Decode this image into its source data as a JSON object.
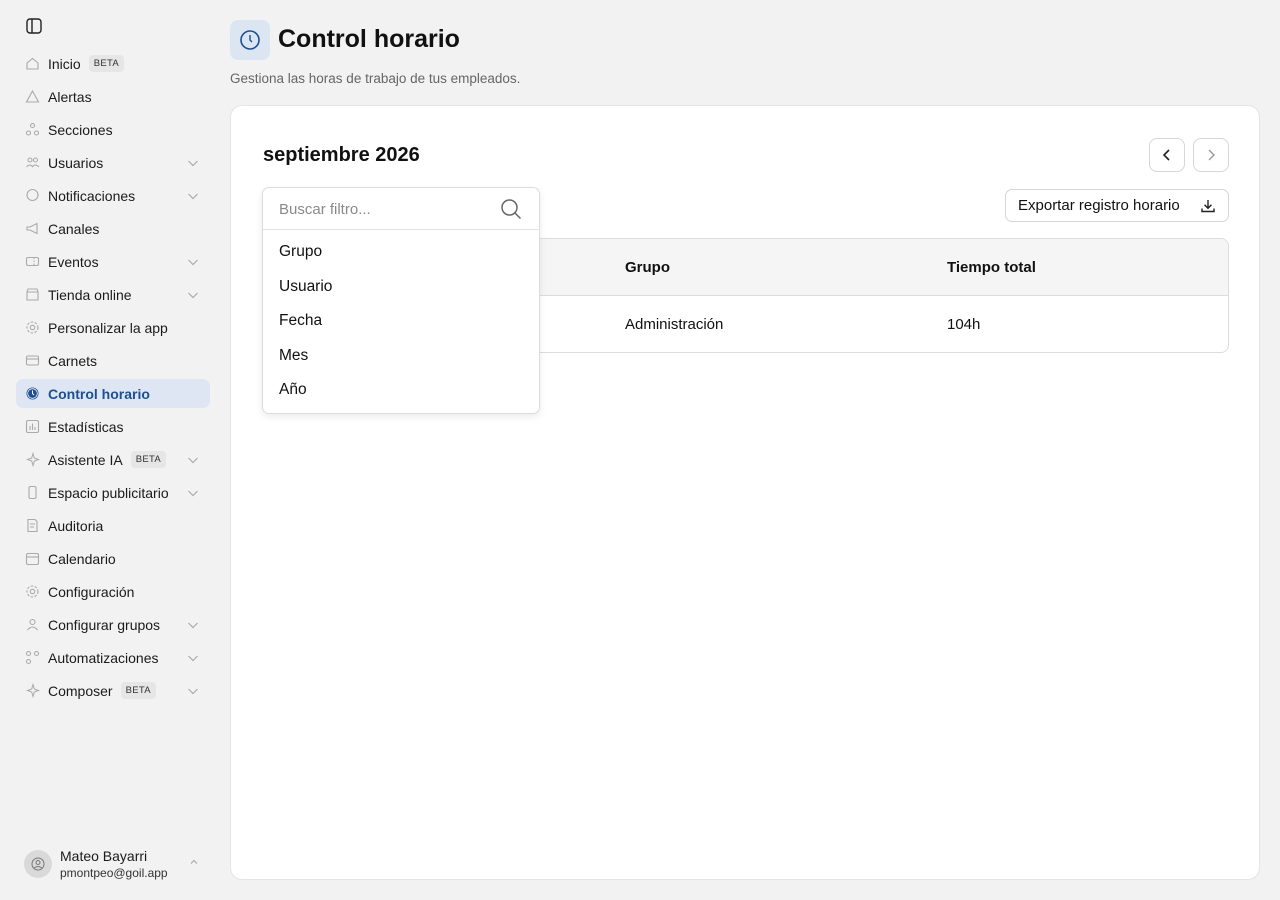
{
  "sidebar": {
    "items": [
      {
        "label": "Inicio",
        "icon": "home-icon",
        "badge": "BETA",
        "chevron": false,
        "active": false
      },
      {
        "label": "Alertas",
        "icon": "alert-icon",
        "badge": null,
        "chevron": false,
        "active": false
      },
      {
        "label": "Secciones",
        "icon": "sections-icon",
        "badge": null,
        "chevron": false,
        "active": false
      },
      {
        "label": "Usuarios",
        "icon": "users-icon",
        "badge": null,
        "chevron": true,
        "active": false
      },
      {
        "label": "Notificaciones",
        "icon": "chat-icon",
        "badge": null,
        "chevron": true,
        "active": false
      },
      {
        "label": "Canales",
        "icon": "megaphone-icon",
        "badge": null,
        "chevron": false,
        "active": false
      },
      {
        "label": "Eventos",
        "icon": "ticket-icon",
        "badge": null,
        "chevron": true,
        "active": false
      },
      {
        "label": "Tienda online",
        "icon": "store-icon",
        "badge": null,
        "chevron": true,
        "active": false
      },
      {
        "label": "Personalizar la app",
        "icon": "gear-icon",
        "badge": null,
        "chevron": false,
        "active": false
      },
      {
        "label": "Carnets",
        "icon": "card-icon",
        "badge": null,
        "chevron": false,
        "active": false
      },
      {
        "label": "Control horario",
        "icon": "clock-icon",
        "badge": null,
        "chevron": false,
        "active": true
      },
      {
        "label": "Estadísticas",
        "icon": "bar-chart-icon",
        "badge": null,
        "chevron": false,
        "active": false
      },
      {
        "label": "Asistente IA",
        "icon": "sparkle-icon",
        "badge": "BETA",
        "chevron": true,
        "active": false
      },
      {
        "label": "Espacio publicitario",
        "icon": "phone-icon",
        "badge": null,
        "chevron": true,
        "active": false
      },
      {
        "label": "Auditoria",
        "icon": "document-icon",
        "badge": null,
        "chevron": false,
        "active": false
      },
      {
        "label": "Calendario",
        "icon": "calendar-icon",
        "badge": null,
        "chevron": false,
        "active": false
      },
      {
        "label": "Configuración",
        "icon": "gear-icon",
        "badge": null,
        "chevron": false,
        "active": false
      },
      {
        "label": "Configurar grupos",
        "icon": "user-group-icon",
        "badge": null,
        "chevron": true,
        "active": false
      },
      {
        "label": "Automatizaciones",
        "icon": "workflow-icon",
        "badge": null,
        "chevron": true,
        "active": false
      },
      {
        "label": "Composer",
        "icon": "sparkle-icon",
        "badge": "BETA",
        "chevron": true,
        "active": false
      }
    ],
    "user": {
      "name": "Mateo Bayarri",
      "email": "pmontpeo@goil.app"
    }
  },
  "header": {
    "title": "Control horario",
    "subtitle": "Gestiona las horas de trabajo de tus empleados."
  },
  "main": {
    "month": "septiembre 2026",
    "export_label": "Exportar registro horario",
    "table": {
      "headers": [
        "Grupo",
        "Tiempo total"
      ],
      "rows": [
        [
          "Administración",
          "104h"
        ]
      ]
    }
  },
  "dropdown": {
    "placeholder": "Buscar filtro...",
    "options": [
      "Grupo",
      "Usuario",
      "Fecha",
      "Mes",
      "Año"
    ]
  },
  "colors": {
    "accent": "#1d4f91",
    "active_bg": "#dfe6f3",
    "background": "#f2f2f2"
  }
}
